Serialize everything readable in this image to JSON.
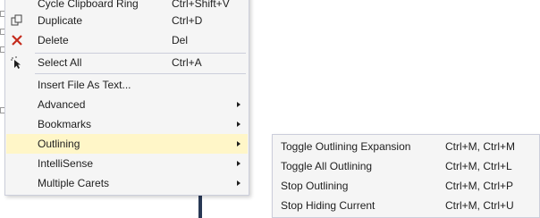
{
  "menu": {
    "items": [
      {
        "label": "Cycle Clipboard Ring",
        "shortcut": "Ctrl+Shift+V",
        "icon": ""
      },
      {
        "label": "Duplicate",
        "shortcut": "Ctrl+D",
        "icon": "duplicate-icon"
      },
      {
        "label": "Delete",
        "shortcut": "Del",
        "icon": "delete-icon"
      },
      {
        "label": "Select All",
        "shortcut": "Ctrl+A",
        "icon": "select-all-icon"
      },
      {
        "label": "Insert File As Text...",
        "shortcut": "",
        "icon": ""
      },
      {
        "label": "Advanced",
        "shortcut": "",
        "submenu": true
      },
      {
        "label": "Bookmarks",
        "shortcut": "",
        "submenu": true
      },
      {
        "label": "Outlining",
        "shortcut": "",
        "submenu": true,
        "highlighted": true
      },
      {
        "label": "IntelliSense",
        "shortcut": "",
        "submenu": true
      },
      {
        "label": "Multiple Carets",
        "shortcut": "",
        "submenu": true
      }
    ]
  },
  "submenu": {
    "items": [
      {
        "label": "Toggle Outlining Expansion",
        "shortcut": "Ctrl+M, Ctrl+M"
      },
      {
        "label": "Toggle All Outlining",
        "shortcut": "Ctrl+M, Ctrl+L"
      },
      {
        "label": "Stop Outlining",
        "shortcut": "Ctrl+M, Ctrl+P"
      },
      {
        "label": "Stop Hiding Current",
        "shortcut": "Ctrl+M, Ctrl+U"
      }
    ]
  },
  "colors": {
    "menu_bg": "#f5f5f5",
    "highlight": "#fff6c8",
    "border": "#cccedb",
    "delete_icon": "#c42b1c"
  }
}
